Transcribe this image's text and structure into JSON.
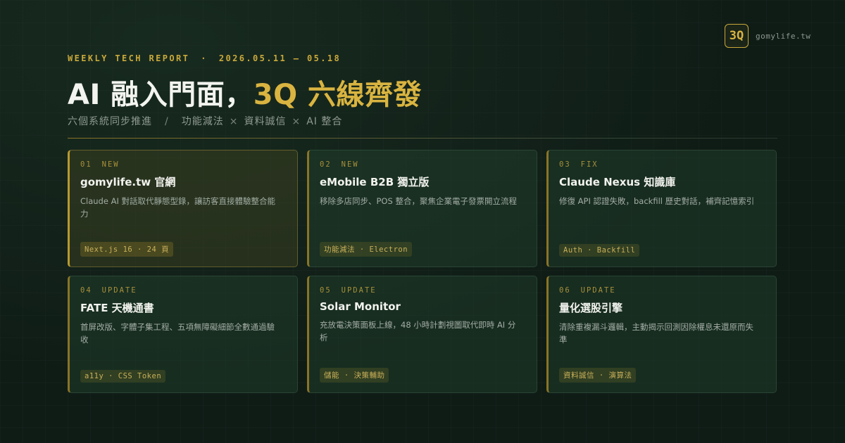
{
  "brand": {
    "logo": "3Q",
    "domain": "gomylife.tw"
  },
  "header": {
    "kicker": "WEEKLY TECH REPORT",
    "kicker_dot": "·",
    "date_range": "2026.05.11 – 05.18",
    "title_main": "AI 融入門面，",
    "title_accent": "3Q 六線齊發",
    "subtitle_lead": "六個系統同步推進",
    "subtitle_sep": "/",
    "subtitle_items": [
      "功能減法",
      "資料誠信",
      "AI 整合"
    ],
    "subtitle_x": "×"
  },
  "colors": {
    "accent": "#d9b440",
    "background": "#0f1c16",
    "card": "#1f3a28"
  },
  "cards": [
    {
      "num": "01",
      "status": "NEW",
      "title": "gomylife.tw 官網",
      "desc": "Claude AI 對話取代靜態型錄，讓訪客直接體驗整合能力",
      "tag": "Next.js 16 · 24 頁"
    },
    {
      "num": "02",
      "status": "NEW",
      "title": "eMobile B2B 獨立版",
      "desc": "移除多店同步、POS 整合，聚焦企業電子發票開立流程",
      "tag": "功能減法 · Electron"
    },
    {
      "num": "03",
      "status": "FIX",
      "title": "Claude Nexus 知識庫",
      "desc": "修復 API 認證失敗，backfill 歷史對話，補齊記憶索引",
      "tag": "Auth · Backfill"
    },
    {
      "num": "04",
      "status": "UPDATE",
      "title": "FATE 天機通書",
      "desc": "首屏改版、字體子集工程、五項無障礙細節全數通過驗收",
      "tag": "a11y · CSS Token"
    },
    {
      "num": "05",
      "status": "UPDATE",
      "title": "Solar Monitor",
      "desc": "充放電決策面板上線，48 小時計劃視圖取代即時 AI 分析",
      "tag": "儲能 · 決策輔助"
    },
    {
      "num": "06",
      "status": "UPDATE",
      "title": "量化選股引擎",
      "desc": "清除重複漏斗邏輯，主動揭示回測因除權息未還原而失準",
      "tag": "資料誠信 · 演算法"
    }
  ]
}
